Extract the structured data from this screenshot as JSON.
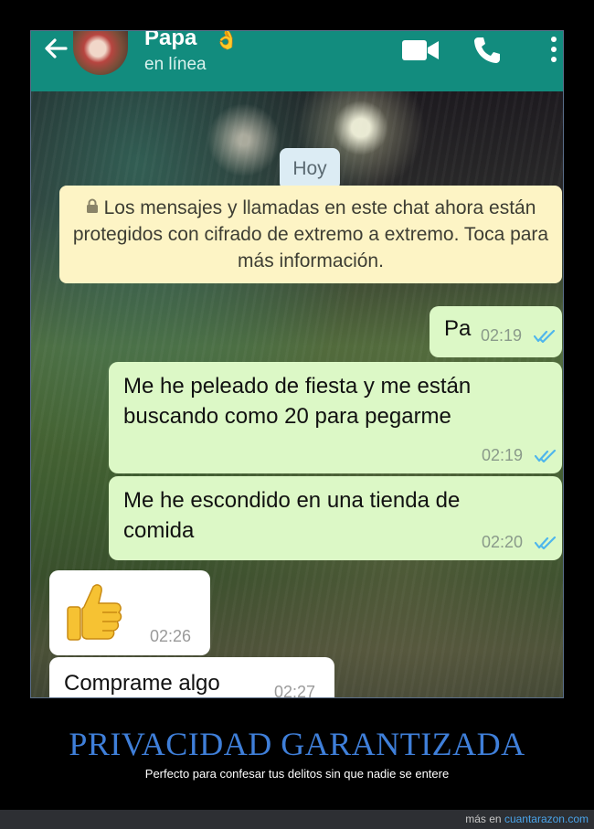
{
  "header": {
    "contact_name": "Papa",
    "contact_emoji": "👌",
    "status": "en línea",
    "icons": {
      "back": "arrow-left-icon",
      "video": "video-camera-icon",
      "call": "phone-icon",
      "menu": "kebab-menu-icon"
    },
    "color": "#128c7e"
  },
  "chat": {
    "date_chip": "Hoy",
    "system_message": "Los mensajes y llamadas en este chat ahora están protegidos con cifrado de extremo a extremo. Toca para más información.",
    "messages": [
      {
        "direction": "out",
        "text": "Pa",
        "time": "02:19",
        "status": "read"
      },
      {
        "direction": "out",
        "text": "Me he peleado de fiesta y me están buscando como 20 para pegarme",
        "time": "02:19",
        "status": "read"
      },
      {
        "direction": "out",
        "text": "Me he escondido en una tienda de comida",
        "time": "02:20",
        "status": "read"
      },
      {
        "direction": "in",
        "text": "",
        "emoji": "thumbs-up",
        "time": "02:26"
      },
      {
        "direction": "in",
        "text": "Comprame algo",
        "time": "02:27"
      }
    ]
  },
  "caption": {
    "title": "PRIVACIDAD GARANTIZADA",
    "subtitle": "Perfecto para confesar tus delitos sin que nadie se entere"
  },
  "footer": {
    "prefix": "más en",
    "site": "cuantarazon.com"
  },
  "colors": {
    "outgoing_bubble": "#dcf8c6",
    "incoming_bubble": "#ffffff",
    "read_ticks": "#4fb6ec",
    "caption_title": "#3f7fd9"
  }
}
